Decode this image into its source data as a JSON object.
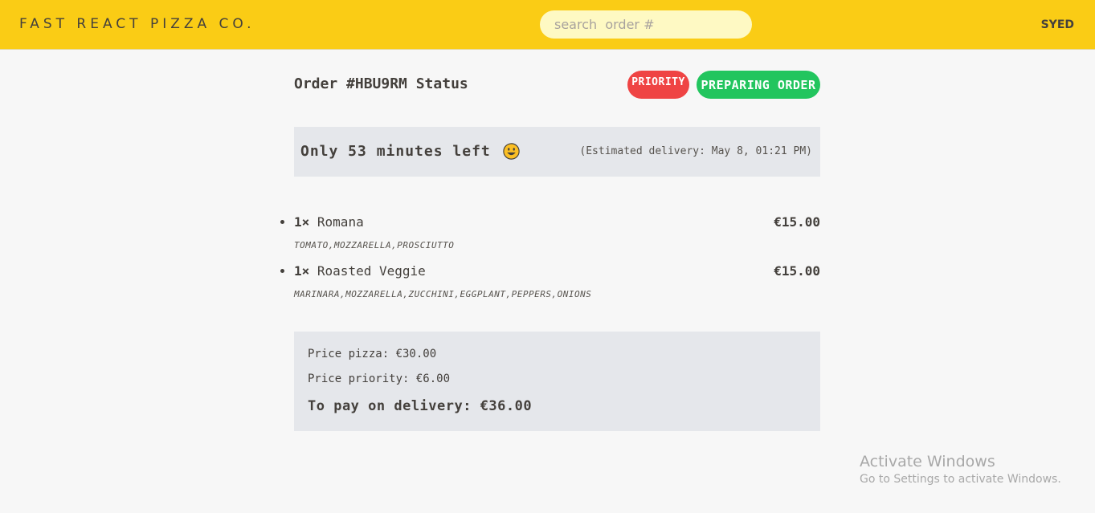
{
  "header": {
    "logo": "Fast React Pizza Co.",
    "search_placeholder": "search  order #",
    "username": "SYED"
  },
  "order": {
    "title": "Order #HBU9RM Status",
    "priority_badge": "PRIORITY",
    "status_badge": "PREPARING ORDER",
    "time_left": "Only 53 minutes left",
    "emoji": "😃",
    "estimated_delivery": "(Estimated delivery: May 8, 01:21 PM)",
    "items": [
      {
        "qty": "1×",
        "name": "Romana",
        "price": "€15.00",
        "ingredients": "TOMATO,MOZZARELLA,PROSCIUTTO"
      },
      {
        "qty": "1×",
        "name": "Roasted Veggie",
        "price": "€15.00",
        "ingredients": "MARINARA,MOZZARELLA,ZUCCHINI,EGGPLANT,PEPPERS,ONIONS"
      }
    ],
    "price_pizza": "Price pizza: €30.00",
    "price_priority": "Price priority: €6.00",
    "to_pay": "To pay on delivery: €36.00"
  },
  "watermark": {
    "title": "Activate Windows",
    "subtitle": "Go to Settings to activate Windows."
  },
  "colors": {
    "header_bg": "#facc15",
    "priority": "#ef4444",
    "status": "#22c55e",
    "panel": "#e5e7eb"
  }
}
